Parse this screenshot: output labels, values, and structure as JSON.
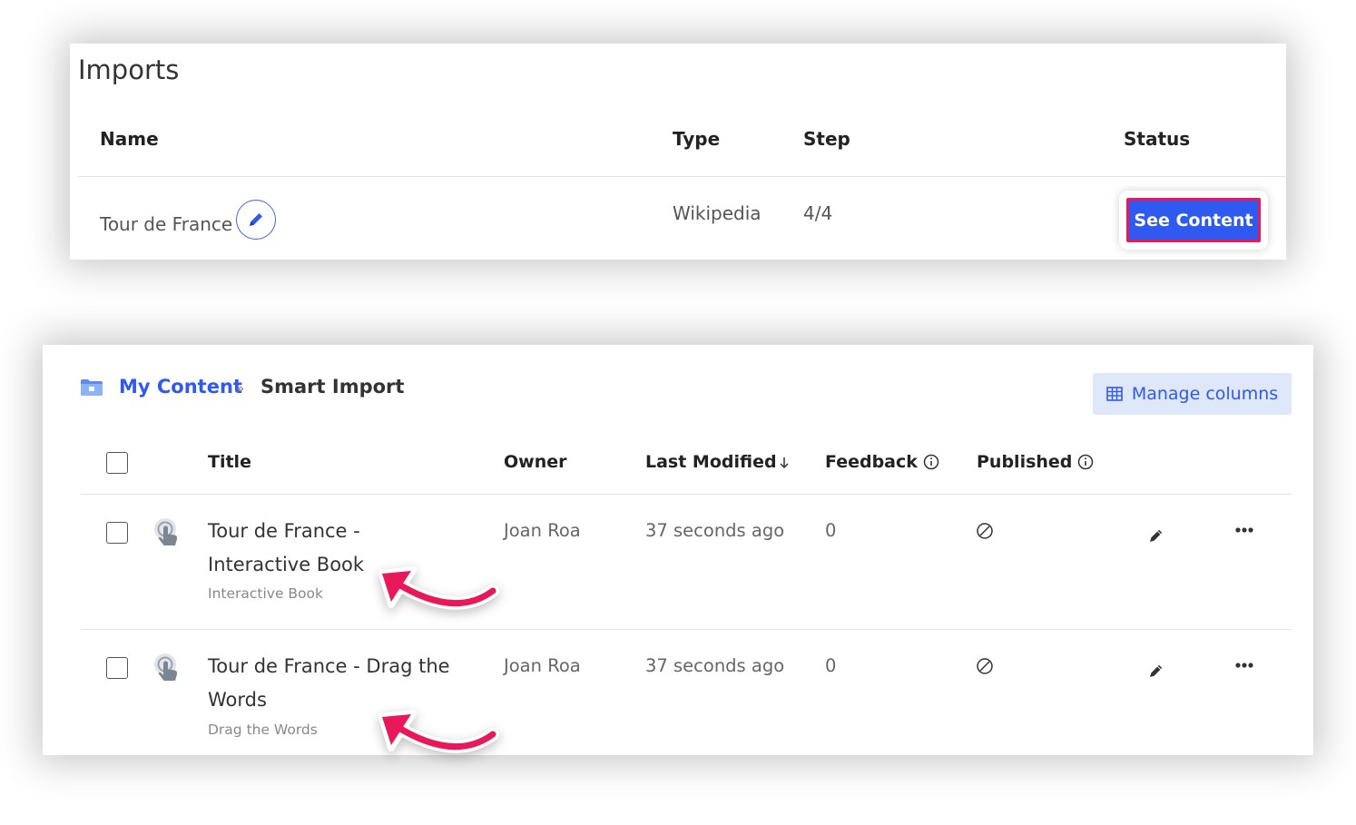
{
  "imports": {
    "title": "Imports",
    "columns": {
      "name": "Name",
      "type": "Type",
      "step": "Step",
      "status": "Status"
    },
    "row": {
      "name": "Tour de France",
      "type": "Wikipedia",
      "step": "4/4",
      "action": "See Content"
    }
  },
  "content": {
    "breadcrumb": {
      "root": "My Content",
      "separator": "»",
      "current": "Smart Import"
    },
    "manage_columns": "Manage columns",
    "columns": {
      "title": "Title",
      "owner": "Owner",
      "last_modified": "Last Modified",
      "feedback": "Feedback",
      "published": "Published"
    },
    "rows": [
      {
        "title_line1": "Tour de France -",
        "title_line2": "Interactive Book",
        "subtitle": "Interactive Book",
        "owner": "Joan Roa",
        "last_modified": "37 seconds ago",
        "feedback": "0"
      },
      {
        "title_line1": "Tour de France - Drag the",
        "title_line2": "Words",
        "subtitle": "Drag the Words",
        "owner": "Joan Roa",
        "last_modified": "37 seconds ago",
        "feedback": "0"
      }
    ]
  },
  "colors": {
    "accent_blue": "#2f5af0",
    "highlight_pink": "#e8185a",
    "manage_bg": "#dfe7fb"
  },
  "icons": [
    "pencil-icon",
    "folder-icon",
    "table-icon",
    "info-icon",
    "sort-down-icon",
    "hand-pointer-icon",
    "not-published-icon",
    "more-icon",
    "annotation-arrow"
  ]
}
